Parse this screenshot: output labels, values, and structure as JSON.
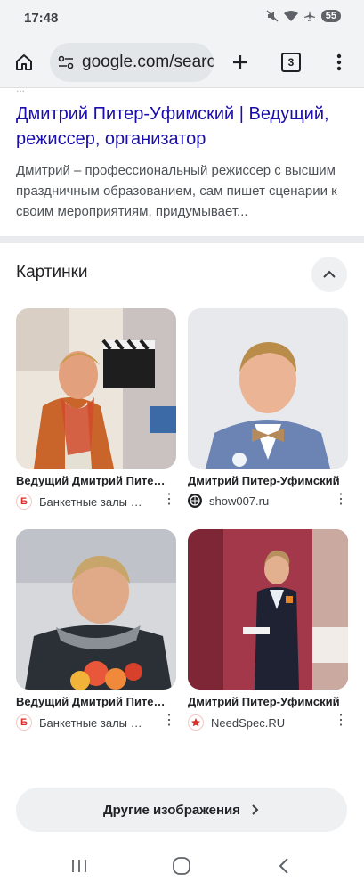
{
  "status": {
    "time": "17:48",
    "battery": "55"
  },
  "browser": {
    "url": "google.com/search",
    "tabs_count": "3"
  },
  "result": {
    "prev_snippet": "...",
    "title": "Дмитрий Питер-Уфимский | Ведущий, режиссер, организатор",
    "snippet": "Дмитрий – профессиональный режиссер с высшим праздничным образованием, сам пишет сценарии к своим мероприятиям, придумывает..."
  },
  "images": {
    "heading": "Картинки",
    "items": [
      {
        "title": "Ведущий Дмитрий Питер-Уфимский",
        "source": "Банкетные залы Москвы",
        "favicon": "red-b-icon"
      },
      {
        "title": "Дмитрий Питер-Уфимский",
        "source": "show007.ru",
        "favicon": "globe-icon"
      },
      {
        "title": "Ведущий Дмитрий Питер-Уфимский",
        "source": "Банкетные залы Москвы",
        "favicon": "red-b-icon"
      },
      {
        "title": "Дмитрий Питер-Уфимский",
        "source": "NeedSpec.RU",
        "favicon": "star-icon"
      }
    ],
    "more_label": "Другие изображения"
  },
  "colors": {
    "link": "#1a0dab",
    "chrome_bg": "#f1f3f4",
    "pill_bg": "#eef0f1"
  }
}
